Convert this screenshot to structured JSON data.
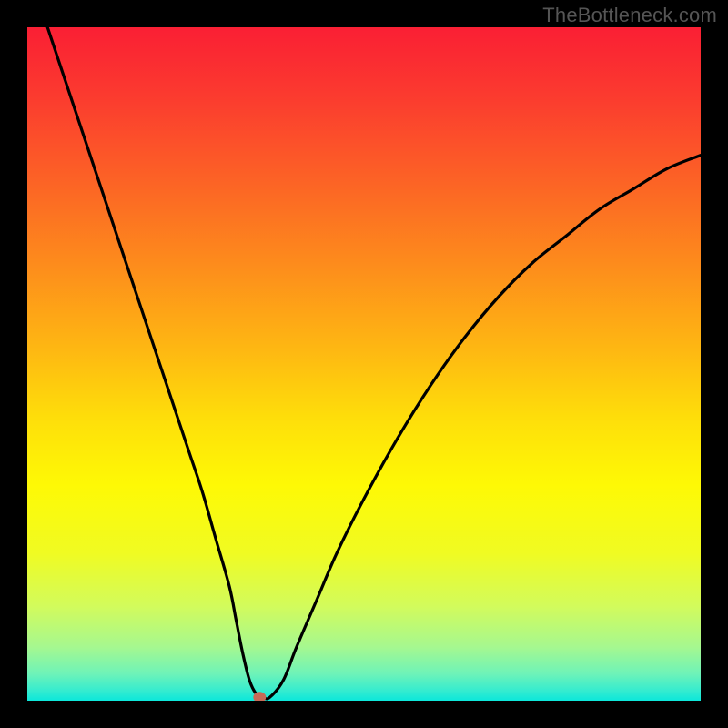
{
  "watermark": "TheBottleneck.com",
  "chart_data": {
    "type": "line",
    "title": "",
    "xlabel": "",
    "ylabel": "",
    "xlim": [
      0,
      100
    ],
    "ylim": [
      0,
      100
    ],
    "x": [
      3,
      8,
      12,
      16,
      20,
      24,
      26,
      28,
      30,
      31,
      32,
      33,
      34,
      35,
      36,
      38,
      40,
      43,
      46,
      50,
      55,
      60,
      65,
      70,
      75,
      80,
      85,
      90,
      95,
      100
    ],
    "values": [
      100,
      85,
      73,
      61,
      49,
      37,
      31,
      24,
      17,
      12,
      7,
      3,
      1,
      0.5,
      0.5,
      3,
      8,
      15,
      22,
      30,
      39,
      47,
      54,
      60,
      65,
      69,
      73,
      76,
      79,
      81
    ],
    "marker": {
      "x": 34.5,
      "y": 0.5
    },
    "gradient_stops": [
      {
        "offset": 0.0,
        "color": "#fa1f34"
      },
      {
        "offset": 0.1,
        "color": "#fb3a2f"
      },
      {
        "offset": 0.22,
        "color": "#fc6026"
      },
      {
        "offset": 0.35,
        "color": "#fd8b1c"
      },
      {
        "offset": 0.48,
        "color": "#feb812"
      },
      {
        "offset": 0.58,
        "color": "#fede0a"
      },
      {
        "offset": 0.68,
        "color": "#fef905"
      },
      {
        "offset": 0.78,
        "color": "#f0fb22"
      },
      {
        "offset": 0.86,
        "color": "#d2fb5c"
      },
      {
        "offset": 0.92,
        "color": "#a6f88f"
      },
      {
        "offset": 0.96,
        "color": "#6ef3b8"
      },
      {
        "offset": 0.985,
        "color": "#35eccf"
      },
      {
        "offset": 1.0,
        "color": "#0ce7da"
      }
    ]
  }
}
